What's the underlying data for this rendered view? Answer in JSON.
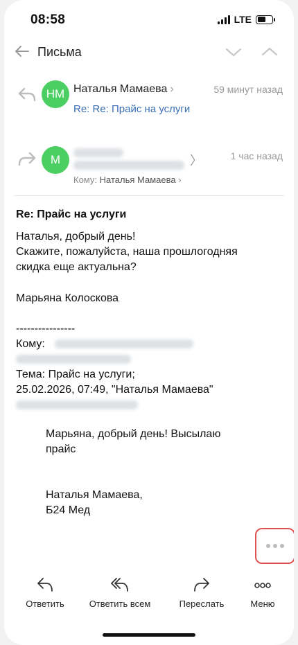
{
  "status": {
    "time": "08:58",
    "network": "LTE"
  },
  "nav": {
    "title": "Письма"
  },
  "messages": [
    {
      "avatar_initials": "НМ",
      "sender": "Наталья Мамаева",
      "sender_chevron": "›",
      "time": "59 минут назад",
      "subject": "Re: Re: Прайс на услуги"
    },
    {
      "avatar_initials": "М",
      "sender_chevron": "〉",
      "time": "1 час назад",
      "to_label": "Кому:",
      "to_name": "Наталья Мамаева",
      "to_chevron": "›"
    }
  ],
  "body": {
    "subject": "Re: Прайс на услуги",
    "greeting": "Наталья, добрый день!",
    "question": "Скажите, пожалуйста, наша прошлогодняя\nскидка еще актуальна?",
    "signature": "Марьяна Колоскова",
    "separator": "----------------",
    "to_label": "Кому:",
    "topic": "Тема: Прайс на услуги;",
    "date_line": "25.02.2026, 07:49, \"Наталья Мамаева\"",
    "quoted_greeting": "Марьяна, добрый день! Высылаю\nпрайс",
    "quoted_signature": "Наталья Мамаева,\nБ24 Мед"
  },
  "toolbar": {
    "reply": "Ответить",
    "reply_all": "Ответить всем",
    "forward": "Переслать",
    "menu": "Меню"
  },
  "colors": {
    "accent_green": "#4ccf62",
    "subject_blue": "#3a6fb3",
    "highlight_red": "#e05252"
  }
}
